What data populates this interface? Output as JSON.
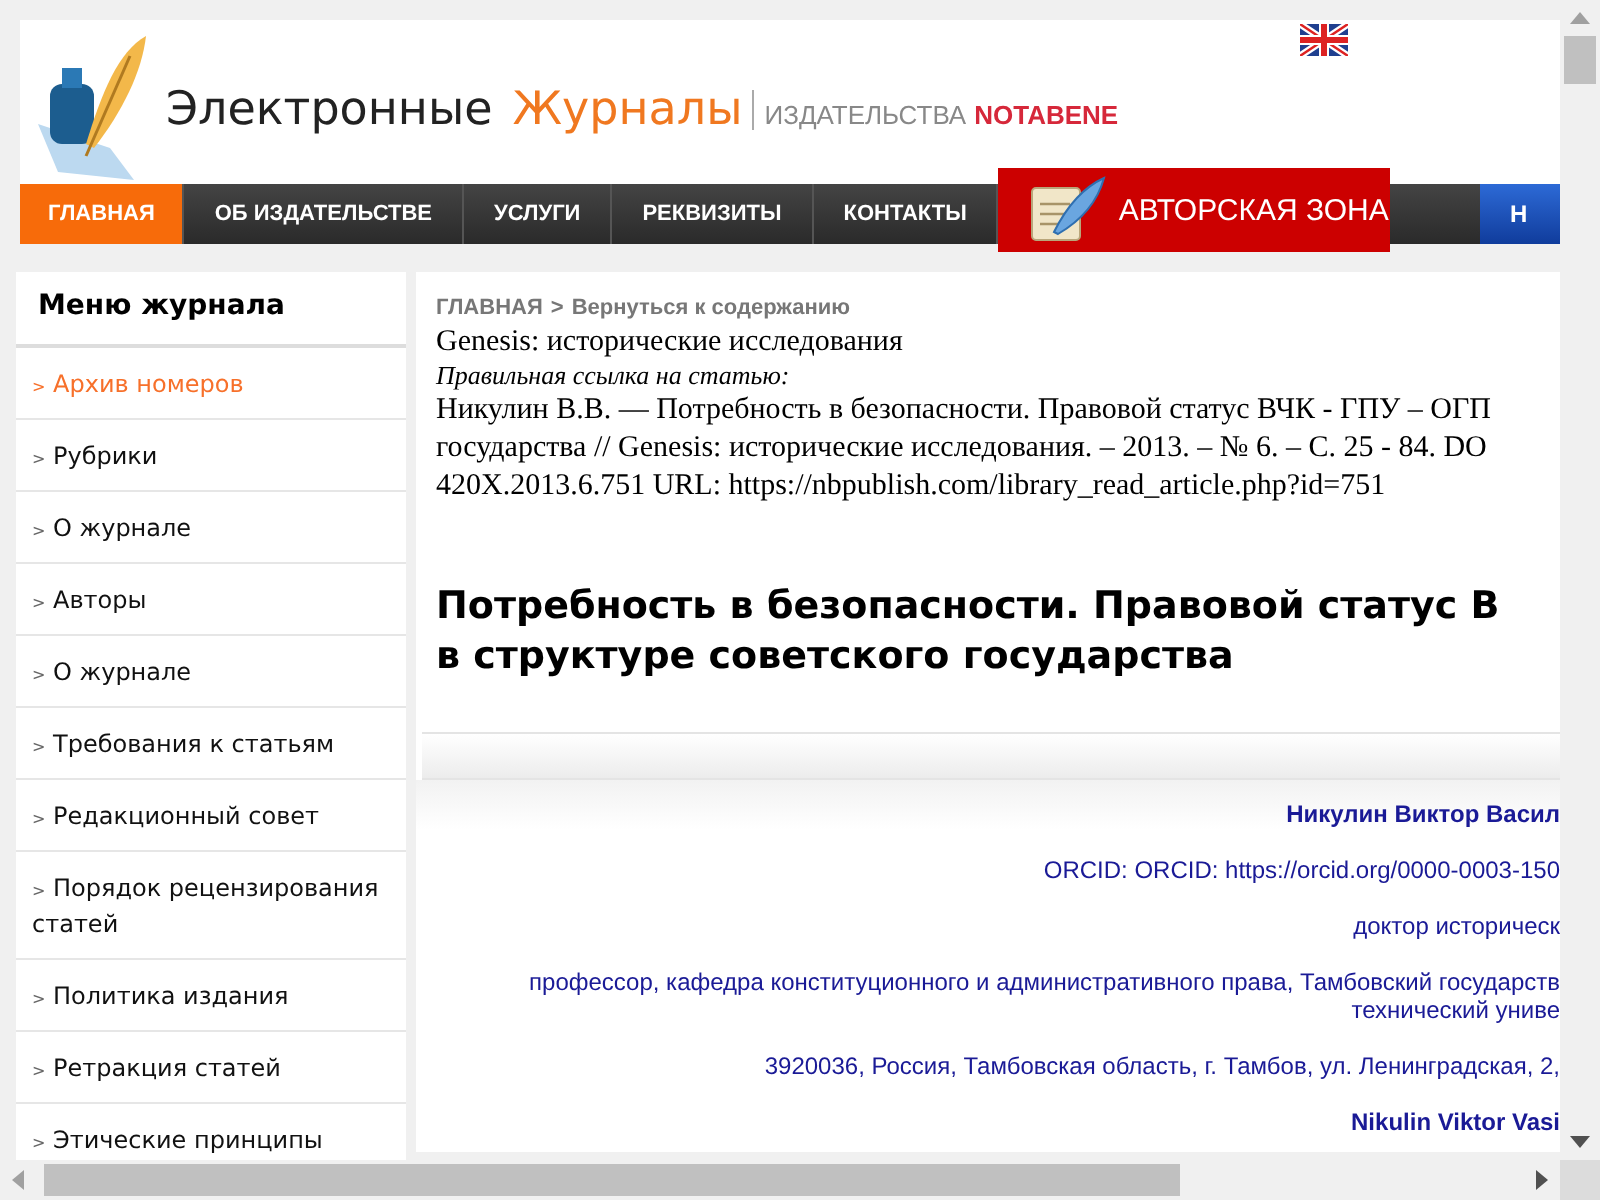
{
  "header": {
    "logo": {
      "word_1": "Электронные",
      "word_2": "Журналы",
      "publisher": "ИЗДАТЕЛЬСТВА",
      "brand": "NOTABENE"
    }
  },
  "nav": {
    "items": [
      {
        "label": "ГЛАВНАЯ",
        "selected": true
      },
      {
        "label": "ОБ ИЗДАТЕЛЬСТВЕ",
        "selected": false
      },
      {
        "label": "УСЛУГИ",
        "selected": false
      },
      {
        "label": "РЕКВИЗИТЫ",
        "selected": false
      },
      {
        "label": "КОНТАКТЫ",
        "selected": false
      }
    ],
    "author_zone": "АВТОРСКАЯ ЗОНА",
    "cut_item": "Н"
  },
  "sidebar": {
    "title": "Меню журнала",
    "items": [
      {
        "marker": ">",
        "label": "Архив номеров",
        "selected": true
      },
      {
        "marker": ">",
        "label": "Рубрики",
        "selected": false
      },
      {
        "marker": ">",
        "label": "О журнале",
        "selected": false
      },
      {
        "marker": ">",
        "label": "Авторы",
        "selected": false
      },
      {
        "marker": ">",
        "label": "О журнале",
        "selected": false
      },
      {
        "marker": ">",
        "label": "Требования к статьям",
        "selected": false
      },
      {
        "marker": ">",
        "label": "Редакционный совет",
        "selected": false
      },
      {
        "marker": ">",
        "label": "Порядок рецензирования статей",
        "selected": false
      },
      {
        "marker": ">",
        "label": "Политика издания",
        "selected": false
      },
      {
        "marker": ">",
        "label": "Ретракция статей",
        "selected": false
      },
      {
        "marker": ">",
        "label": "Этические принципы",
        "selected": false
      }
    ]
  },
  "article": {
    "breadcrumb": {
      "home": "ГЛАВНАЯ",
      "separator": ">",
      "back": "Вернуться к содержанию"
    },
    "journal": "Genesis: исторические исследования",
    "citation_label": "Правильная ссылка на статью:",
    "citation_lines": [
      "Никулин В.В. — Потребность в безопасности. Правовой статус ВЧК - ГПУ – ОГП",
      "государства // Genesis: исторические исследования. – 2013. – № 6. – С. 25 - 84. DO",
      "420X.2013.6.751 URL: https://nbpublish.com/library_read_article.php?id=751"
    ],
    "title_lines": [
      "Потребность в безопасности. Правовой статус В",
      "в структуре советского государства"
    ],
    "author": {
      "name": "Никулин Виктор Васил",
      "orcid": "ORCID: ORCID: https://orcid.org/0000-0003-150",
      "degree": "доктор историческ",
      "position_lines": [
        "профессор, кафедра конституционного и административного права, Тамбовский государств",
        "технический униве"
      ],
      "address": "3920036, Россия, Тамбовская область, г. Тамбов, ул. Ленинградская, 2,",
      "name_en": "Nikulin Viktor Vasi"
    }
  }
}
